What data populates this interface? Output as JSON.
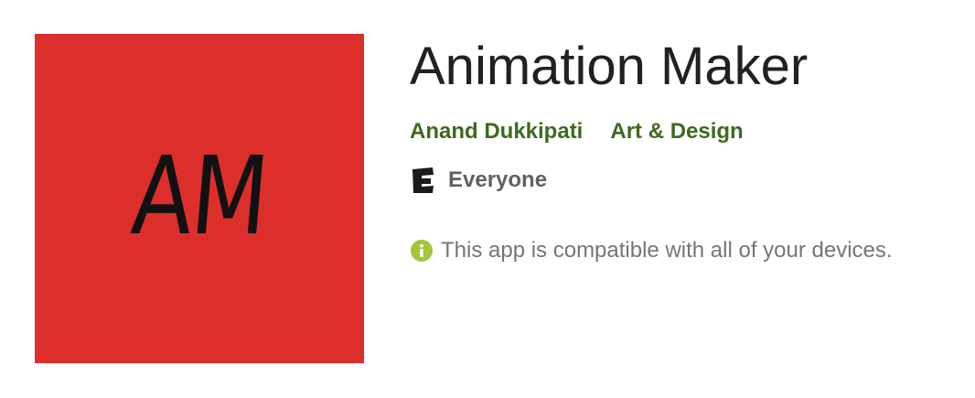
{
  "app": {
    "icon_text": "AM",
    "icon_color": "#dc2f2c",
    "title": "Animation Maker",
    "developer": "Anand Dukkipati",
    "category": "Art & Design",
    "content_rating": "Everyone",
    "content_rating_icon": "esrb-e-icon",
    "compatibility_icon": "info-icon",
    "compatibility_message": "This app is compatible with all of your devices."
  },
  "colors": {
    "link_green": "#3d6a20",
    "info_green": "#a4c639",
    "title_text": "#212121",
    "muted_text": "#757575"
  }
}
